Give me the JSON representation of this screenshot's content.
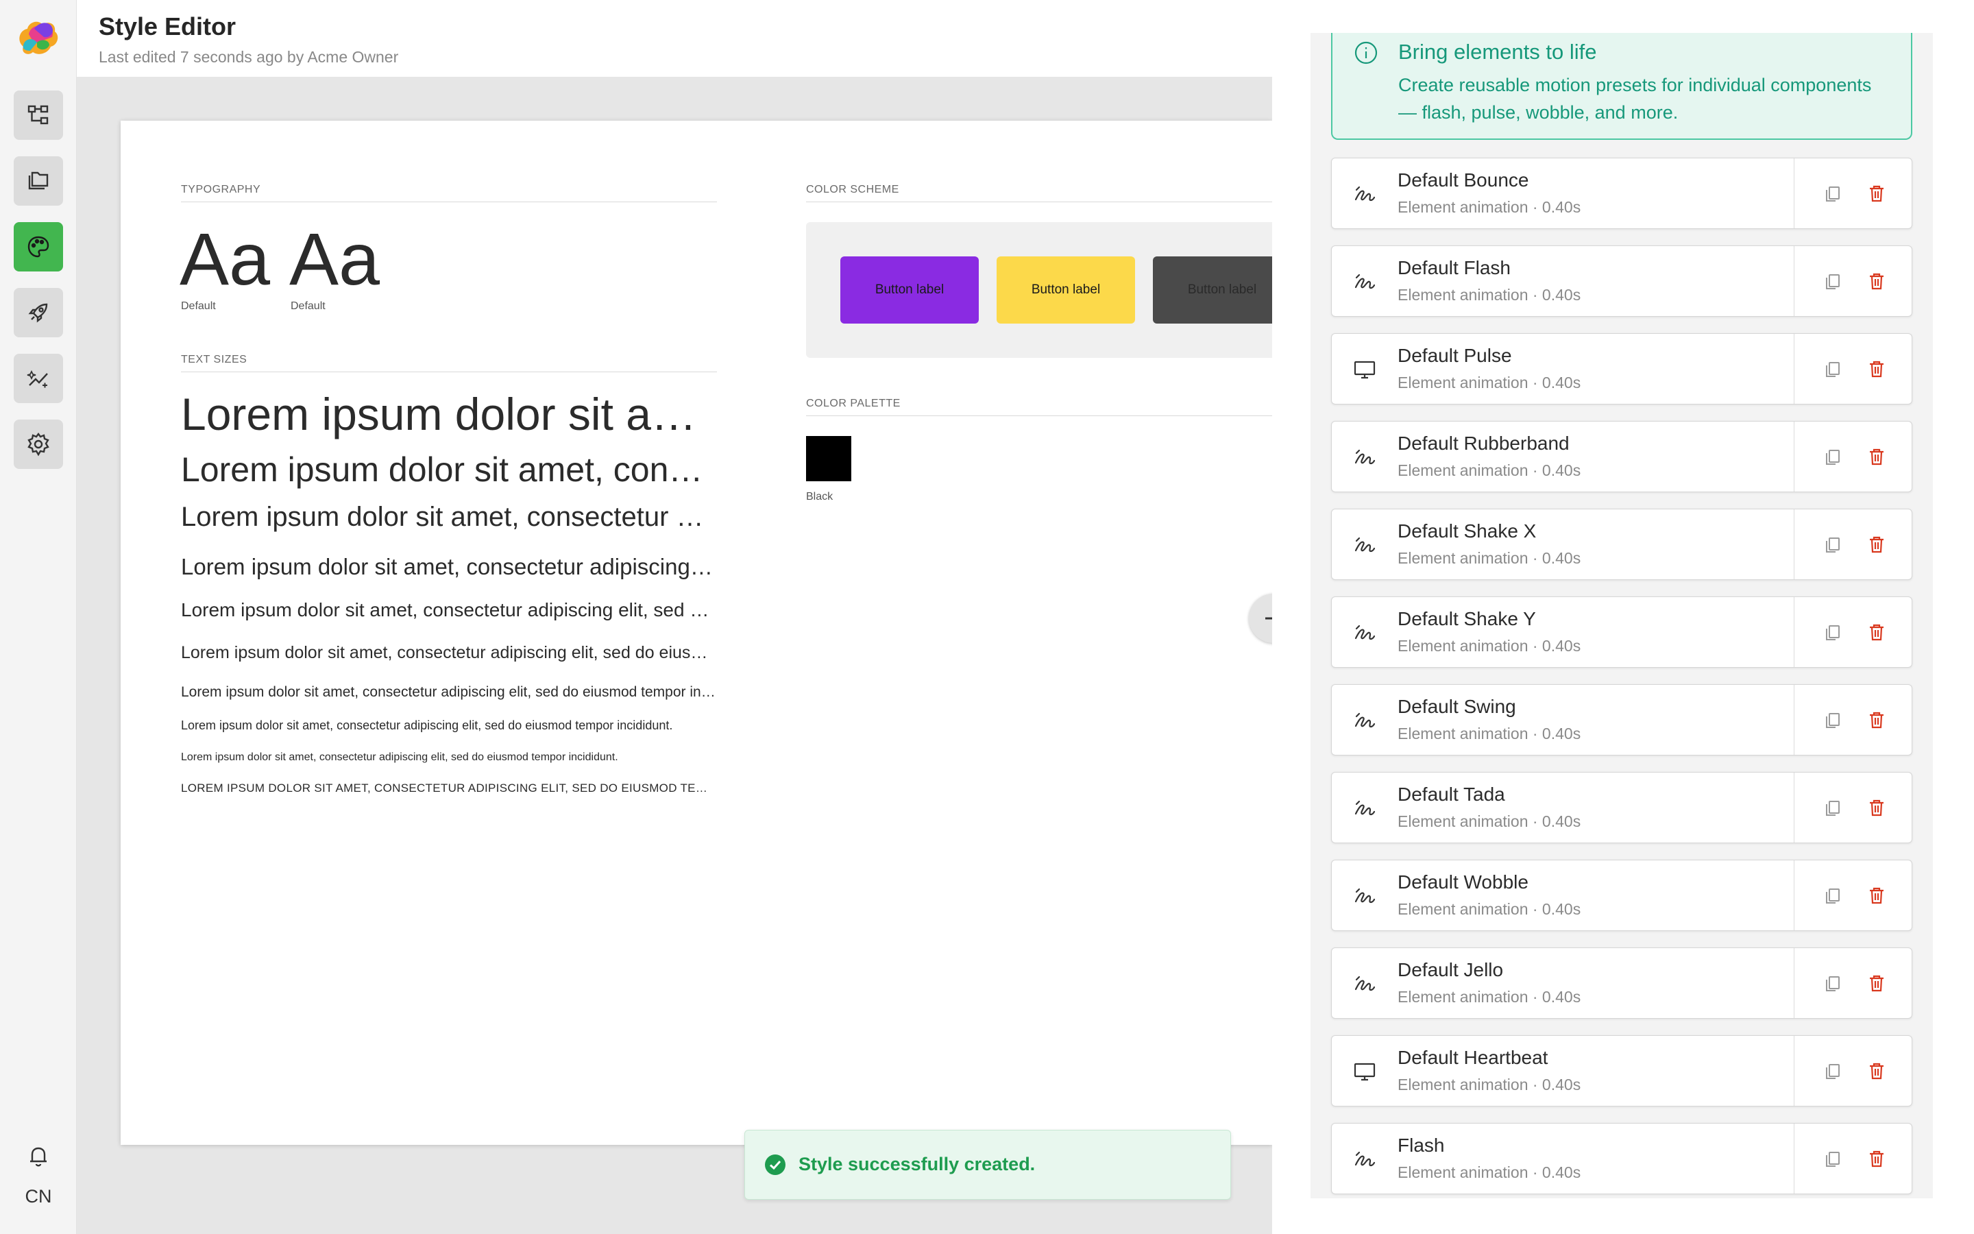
{
  "header": {
    "title": "Style Editor",
    "subtitle": "Last edited 7 seconds ago by Acme Owner"
  },
  "rail": {
    "items": [
      {
        "name": "sitemap-icon"
      },
      {
        "name": "folder-icon"
      },
      {
        "name": "palette-icon",
        "active": true
      },
      {
        "name": "rocket-icon"
      },
      {
        "name": "magic-icon"
      },
      {
        "name": "gear-icon"
      }
    ],
    "user_initials": "CN"
  },
  "sheet": {
    "typography_label": "TYPOGRAPHY",
    "typography_samples": [
      {
        "glyph": "Aa",
        "caption": "Default"
      },
      {
        "glyph": "Aa",
        "caption": "Default"
      }
    ],
    "text_sizes_label": "TEXT SIZES",
    "text_sizes": [
      "Lorem ipsum dolor sit amet, consectetur adipiscing elit, sed do eiusmod tempor incididunt.",
      "Lorem ipsum dolor sit amet, consectetur adipiscing elit, sed do eiusmod tempor incididunt.",
      "Lorem ipsum dolor sit amet, consectetur adipiscing elit, sed do eiusmod tempor incididunt.",
      "Lorem ipsum dolor sit amet, consectetur adipiscing elit, sed do eiusmod tempor incididunt.",
      "Lorem ipsum dolor sit amet, consectetur adipiscing elit, sed do eiusmod tempor incididunt.",
      "Lorem ipsum dolor sit amet, consectetur adipiscing elit, sed do eiusmod tempor incididunt.",
      "Lorem ipsum dolor sit amet, consectetur adipiscing elit, sed do eiusmod tempor incididunt.",
      "Lorem ipsum dolor sit amet, consectetur adipiscing elit, sed do eiusmod tempor incididunt.",
      "Lorem ipsum dolor sit amet, consectetur adipiscing elit, sed do eiusmod tempor incididunt.",
      "LOREM IPSUM DOLOR SIT AMET, CONSECTETUR ADIPISCING ELIT, SED DO EIUSMOD TEMPOR INCIDIDUNT."
    ],
    "color_scheme_label": "COLOR SCHEME",
    "scheme_buttons": [
      {
        "label": "Button label",
        "bg": "#8a2be2",
        "fg": "#1a1a1a"
      },
      {
        "label": "Button label",
        "bg": "#fcd94a",
        "fg": "#1a1a1a"
      },
      {
        "label": "Button label",
        "bg": "#4a4a4a",
        "fg": "#2a2a2a"
      }
    ],
    "color_palette_label": "COLOR PALETTE",
    "palette": [
      {
        "name": "Black",
        "color": "#000000"
      }
    ]
  },
  "toast": {
    "message": "Style successfully created."
  },
  "panel": {
    "info_title": "Bring elements to life",
    "info_body": "Create reusable motion presets for individual components — flash, pulse, wobble, and more.",
    "animations": [
      {
        "name": "Default Bounce",
        "sub": "Element animation · 0.40s",
        "icon": "motion-icon"
      },
      {
        "name": "Default Flash",
        "sub": "Element animation · 0.40s",
        "icon": "motion-icon"
      },
      {
        "name": "Default Pulse",
        "sub": "Element animation · 0.40s",
        "icon": "monitor-icon"
      },
      {
        "name": "Default Rubberband",
        "sub": "Element animation · 0.40s",
        "icon": "motion-icon"
      },
      {
        "name": "Default Shake X",
        "sub": "Element animation · 0.40s",
        "icon": "motion-icon"
      },
      {
        "name": "Default Shake Y",
        "sub": "Element animation · 0.40s",
        "icon": "motion-icon"
      },
      {
        "name": "Default Swing",
        "sub": "Element animation · 0.40s",
        "icon": "motion-icon"
      },
      {
        "name": "Default Tada",
        "sub": "Element animation · 0.40s",
        "icon": "motion-icon"
      },
      {
        "name": "Default Wobble",
        "sub": "Element animation · 0.40s",
        "icon": "motion-icon"
      },
      {
        "name": "Default Jello",
        "sub": "Element animation · 0.40s",
        "icon": "motion-icon"
      },
      {
        "name": "Default Heartbeat",
        "sub": "Element animation · 0.40s",
        "icon": "monitor-icon"
      },
      {
        "name": "Flash",
        "sub": "Element animation · 0.40s",
        "icon": "motion-icon"
      }
    ]
  },
  "colors": {
    "accent_green": "#42b64f",
    "info_teal": "#16987a",
    "delete_red": "#d9381e",
    "success_green": "#1e9c4f"
  }
}
